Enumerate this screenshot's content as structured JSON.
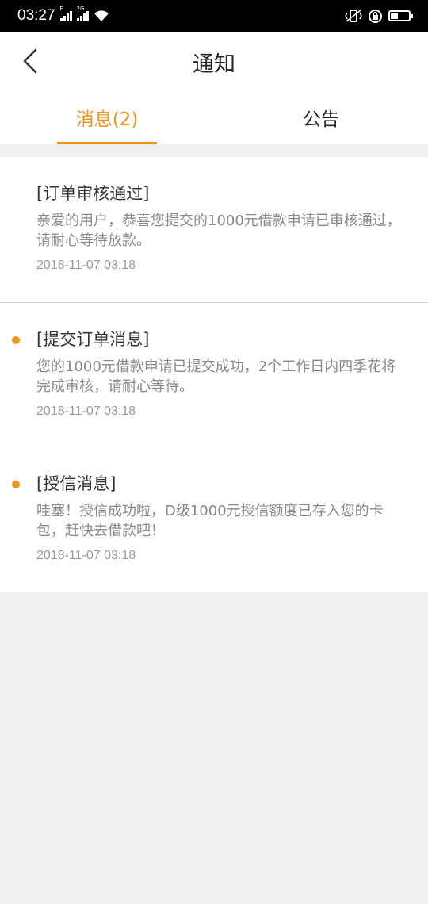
{
  "status_bar": {
    "time": "03:27",
    "signal1_label": "E",
    "signal2_label": "2G"
  },
  "header": {
    "title": "通知"
  },
  "tabs": [
    {
      "label": "消息(2)",
      "active": true
    },
    {
      "label": "公告",
      "active": false
    }
  ],
  "notifications": [
    {
      "title": "[订单审核通过]",
      "body": "亲爱的用户，恭喜您提交的1000元借款申请已审核通过，请耐心等待放款。",
      "time": "2018-11-07 03:18",
      "unread": false
    },
    {
      "title": "[提交订单消息]",
      "body": "您的1000元借款申请已提交成功，2个工作日内四季花将完成审核，请耐心等待。",
      "time": "2018-11-07 03:18",
      "unread": true
    },
    {
      "title": "[授信消息]",
      "body": "哇塞！授信成功啦，D级1000元授信额度已存入您的卡包，赶快去借款吧！",
      "time": "2018-11-07 03:18",
      "unread": true
    }
  ],
  "colors": {
    "accent": "#f39419",
    "background": "#efefef"
  }
}
